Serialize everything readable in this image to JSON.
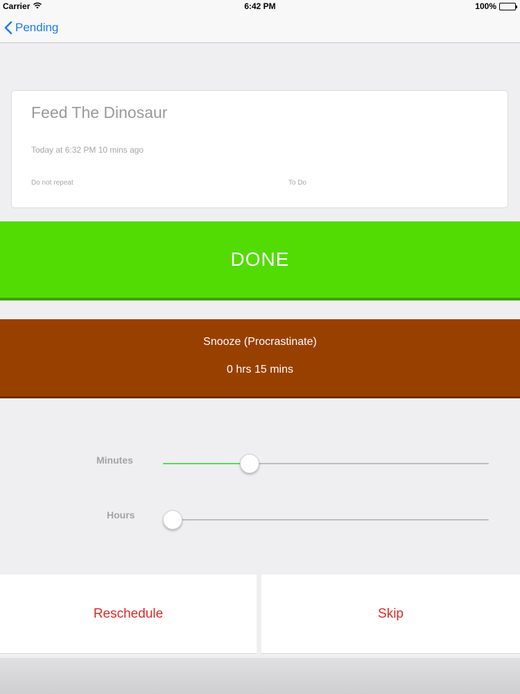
{
  "status_bar": {
    "carrier": "Carrier",
    "time": "6:42 PM",
    "battery": "100%"
  },
  "nav": {
    "back_label": "Pending"
  },
  "task": {
    "title": "Feed The Dinosaur",
    "time": "Today at 6:32 PM 10 mins ago",
    "repeat": "Do not repeat",
    "list": "To Do"
  },
  "actions": {
    "done_label": "DONE",
    "snooze_title": "Snooze (Procrastinate)",
    "snooze_duration": "0 hrs 15 mins",
    "reschedule_label": "Reschedule",
    "skip_label": "Skip"
  },
  "sliders": {
    "minutes": {
      "label": "Minutes",
      "value": 15,
      "max": 60
    },
    "hours": {
      "label": "Hours",
      "value": 0,
      "max": 24
    }
  },
  "colors": {
    "done": "#52dc04",
    "snooze": "#984000",
    "link": "#1a7cf0",
    "danger": "#d92a2a",
    "slider_active": "#5bd95b"
  },
  "icons": {
    "back": "chevron-left-icon",
    "wifi": "wifi-icon",
    "battery": "battery-icon"
  }
}
